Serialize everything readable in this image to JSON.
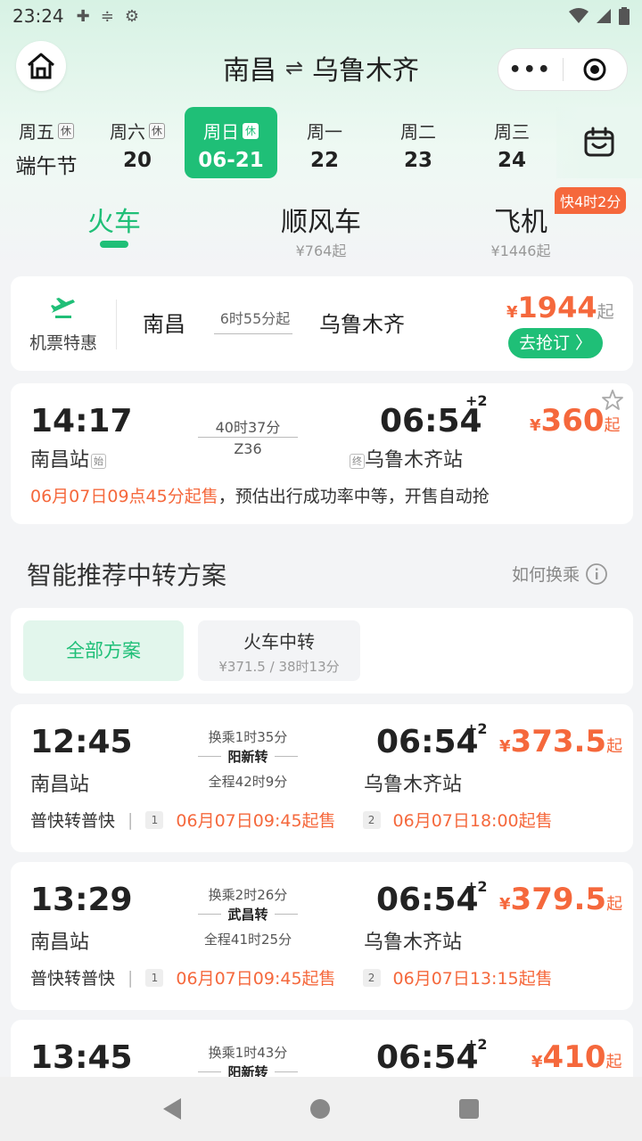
{
  "status_bar": {
    "time": "23:24"
  },
  "nav": {
    "from": "南昌",
    "swap_glyph": "⇌",
    "to": "乌鲁木齐",
    "more_glyph": "•••"
  },
  "dates": [
    {
      "week": "周五",
      "tag": "休",
      "day": "端午节"
    },
    {
      "week": "周六",
      "tag": "休",
      "day": "20"
    },
    {
      "week": "周日",
      "tag": "休",
      "day": "06-21"
    },
    {
      "week": "周一",
      "tag": "",
      "day": "22"
    },
    {
      "week": "周二",
      "tag": "",
      "day": "23"
    },
    {
      "week": "周三",
      "tag": "",
      "day": "24"
    }
  ],
  "modes": {
    "train": {
      "label": "火车"
    },
    "carpool": {
      "label": "顺风车",
      "price": "¥764起"
    },
    "flight": {
      "label": "飞机",
      "price": "¥1446起",
      "badge": "快4时2分"
    }
  },
  "flight_card": {
    "icon_label": "机票特惠",
    "from": "南昌",
    "duration": "6时55分起",
    "to": "乌鲁木齐",
    "currency": "¥",
    "price": "1944",
    "suffix": "起",
    "button": "去抢订 〉"
  },
  "train_card": {
    "depart_time": "14:17",
    "depart_station": "南昌站",
    "depart_tag": "始",
    "duration": "40时37分",
    "train_no": "Z36",
    "arrive_time": "06:54",
    "day_offset": "+2",
    "arrive_tag": "终",
    "arrive_station": "乌鲁木齐站",
    "currency": "¥",
    "price": "360",
    "suffix": "起",
    "note_highlight": "06月07日09点45分起售",
    "note_rest": "，预估出行成功率中等，开售自动抢"
  },
  "transfer_section": {
    "title": "智能推荐中转方案",
    "help_link": "如何换乘",
    "filters": {
      "all": "全部方案",
      "train_label": "火车中转",
      "train_price": "¥371.5",
      "train_sep": "/",
      "train_duration": "38时13分"
    }
  },
  "transfers": [
    {
      "depart_time": "12:45",
      "depart_station": "南昌站",
      "wait": "换乘1时35分",
      "via": "阳新转",
      "total": "全程42时9分",
      "arrive_time": "06:54",
      "day_offset": "+2",
      "arrive_station": "乌鲁木齐站",
      "currency": "¥",
      "price": "373.5",
      "suffix": "起",
      "type": "普快转普快",
      "bar": "|",
      "leg1": "1",
      "sale1": "06月07日09:45起售",
      "leg2": "2",
      "sale2": "06月07日18:00起售"
    },
    {
      "depart_time": "13:29",
      "depart_station": "南昌站",
      "wait": "换乘2时26分",
      "via": "武昌转",
      "total": "全程41时25分",
      "arrive_time": "06:54",
      "day_offset": "+2",
      "arrive_station": "乌鲁木齐站",
      "currency": "¥",
      "price": "379.5",
      "suffix": "起",
      "type": "普快转普快",
      "bar": "|",
      "leg1": "1",
      "sale1": "06月07日09:45起售",
      "leg2": "2",
      "sale2": "06月07日13:15起售"
    },
    {
      "depart_time": "13:45",
      "wait": "换乘1时43分",
      "via": "阳新转",
      "arrive_time": "06:54",
      "day_offset": "+2",
      "currency": "¥",
      "price": "410",
      "suffix": "起"
    }
  ],
  "colors": {
    "accent": "#1fbf77",
    "price": "#f5683c"
  }
}
